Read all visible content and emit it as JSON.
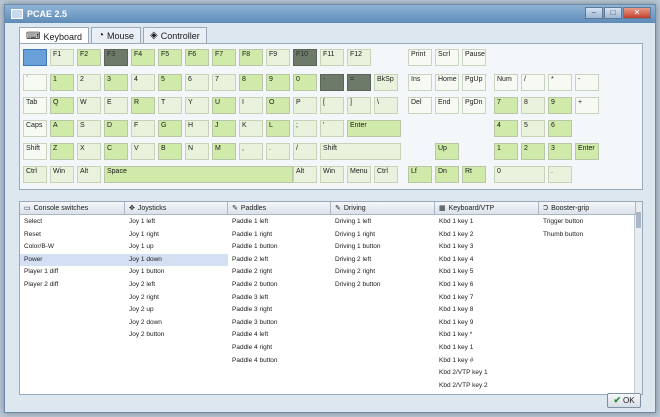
{
  "window": {
    "title": "PCAE 2.5"
  },
  "tabs": [
    {
      "label": "Keyboard",
      "icon": "keyboard-icon",
      "glyph": "⌨"
    },
    {
      "label": "Mouse",
      "icon": "mouse-icon",
      "glyph": "◔"
    },
    {
      "label": "Controller",
      "icon": "controller-icon",
      "glyph": "◈"
    }
  ],
  "keyboard": {
    "keys": [
      {
        "label": "",
        "style": "sel"
      },
      {
        "label": "F1",
        "style": "light"
      },
      {
        "label": "F2",
        "style": ""
      },
      {
        "label": "F3",
        "style": "dark"
      },
      {
        "label": "F4",
        "style": ""
      },
      {
        "label": "F5",
        "style": ""
      },
      {
        "label": "F6",
        "style": ""
      },
      {
        "label": "F7",
        "style": ""
      },
      {
        "label": "F8",
        "style": ""
      },
      {
        "label": "F9",
        "style": "light"
      },
      {
        "label": "F10",
        "style": "dark"
      },
      {
        "label": "F11",
        "style": "light"
      },
      {
        "label": "F12",
        "style": "light"
      },
      {
        "label": "Print",
        "style": "plain"
      },
      {
        "label": "Scrl",
        "style": "plain"
      },
      {
        "label": "Pause",
        "style": "plain"
      },
      {
        "label": "`",
        "style": "plain"
      },
      {
        "label": "1",
        "style": ""
      },
      {
        "label": "2",
        "style": "light"
      },
      {
        "label": "3",
        "style": ""
      },
      {
        "label": "4",
        "style": "light"
      },
      {
        "label": "5",
        "style": ""
      },
      {
        "label": "6",
        "style": "light"
      },
      {
        "label": "7",
        "style": "light"
      },
      {
        "label": "8",
        "style": ""
      },
      {
        "label": "9",
        "style": ""
      },
      {
        "label": "0",
        "style": ""
      },
      {
        "label": "-",
        "style": "dark"
      },
      {
        "label": "=",
        "style": "dark"
      },
      {
        "label": "BkSp",
        "style": "light"
      },
      {
        "label": "Ins",
        "style": "plain"
      },
      {
        "label": "Home",
        "style": "plain"
      },
      {
        "label": "PgUp",
        "style": "plain"
      },
      {
        "label": "Num",
        "style": "plain"
      },
      {
        "label": "/",
        "style": "plain"
      },
      {
        "label": "*",
        "style": "plain"
      },
      {
        "label": "-",
        "style": "plain"
      },
      {
        "label": "Tab",
        "style": "plain"
      },
      {
        "label": "Q",
        "style": ""
      },
      {
        "label": "W",
        "style": "light"
      },
      {
        "label": "E",
        "style": "light"
      },
      {
        "label": "R",
        "style": ""
      },
      {
        "label": "T",
        "style": "light"
      },
      {
        "label": "Y",
        "style": "light"
      },
      {
        "label": "U",
        "style": ""
      },
      {
        "label": "I",
        "style": "light"
      },
      {
        "label": "O",
        "style": ""
      },
      {
        "label": "P",
        "style": "light"
      },
      {
        "label": "[",
        "style": "light"
      },
      {
        "label": "]",
        "style": "light"
      },
      {
        "label": "\\",
        "style": "light"
      },
      {
        "label": "Del",
        "style": "plain"
      },
      {
        "label": "End",
        "style": "plain"
      },
      {
        "label": "PgDn",
        "style": "plain"
      },
      {
        "label": "7",
        "style": ""
      },
      {
        "label": "8",
        "style": "light"
      },
      {
        "label": "9",
        "style": ""
      },
      {
        "label": "+",
        "style": "plain"
      },
      {
        "label": "Caps",
        "style": "plain"
      },
      {
        "label": "A",
        "style": ""
      },
      {
        "label": "S",
        "style": "light"
      },
      {
        "label": "D",
        "style": ""
      },
      {
        "label": "F",
        "style": "light"
      },
      {
        "label": "G",
        "style": ""
      },
      {
        "label": "H",
        "style": "light"
      },
      {
        "label": "J",
        "style": ""
      },
      {
        "label": "K",
        "style": "light"
      },
      {
        "label": "L",
        "style": ""
      },
      {
        "label": ";",
        "style": "light"
      },
      {
        "label": "'",
        "style": "light"
      },
      {
        "label": "Enter",
        "style": ""
      },
      {
        "label": "4",
        "style": ""
      },
      {
        "label": "5",
        "style": "light"
      },
      {
        "label": "6",
        "style": ""
      },
      {
        "label": "Shift",
        "style": "plain"
      },
      {
        "label": "Z",
        "style": ""
      },
      {
        "label": "X",
        "style": "light"
      },
      {
        "label": "C",
        "style": ""
      },
      {
        "label": "V",
        "style": "light"
      },
      {
        "label": "B",
        "style": ""
      },
      {
        "label": "N",
        "style": "light"
      },
      {
        "label": "M",
        "style": ""
      },
      {
        "label": ",",
        "style": "light"
      },
      {
        "label": ".",
        "style": "light"
      },
      {
        "label": "/",
        "style": "light"
      },
      {
        "label": "Shift",
        "style": "light"
      },
      {
        "label": "Up",
        "style": ""
      },
      {
        "label": "1",
        "style": ""
      },
      {
        "label": "2",
        "style": ""
      },
      {
        "label": "3",
        "style": ""
      },
      {
        "label": "Enter",
        "style": ""
      },
      {
        "label": "Ctrl",
        "style": "light"
      },
      {
        "label": "Win",
        "style": "light"
      },
      {
        "label": "Alt",
        "style": "light"
      },
      {
        "label": "Space",
        "style": ""
      },
      {
        "label": "Alt",
        "style": "light"
      },
      {
        "label": "Win",
        "style": "light"
      },
      {
        "label": "Menu",
        "style": "light"
      },
      {
        "label": "Ctrl",
        "style": "light"
      },
      {
        "label": "Lf",
        "style": ""
      },
      {
        "label": "Dn",
        "style": ""
      },
      {
        "label": "Rt",
        "style": ""
      },
      {
        "label": "0",
        "style": "light"
      },
      {
        "label": ".",
        "style": "light"
      }
    ]
  },
  "columns": [
    {
      "header": "Console switches",
      "icon": "console-icon",
      "glyph": "▭",
      "items": [
        "Select",
        "Reset",
        "Color/B-W",
        "Power",
        "Player 1 diff",
        "Player 2 diff"
      ],
      "highlight": 3
    },
    {
      "header": "Joysticks",
      "icon": "joystick-icon",
      "glyph": "✥",
      "items": [
        "Joy 1 left",
        "Joy 1 right",
        "Joy 1 up",
        "Joy 1 down",
        "Joy 1 button",
        "Joy 2 left",
        "Joy 2 right",
        "Joy 2 up",
        "Joy 2 down",
        "Joy 2 button"
      ],
      "highlight": 3
    },
    {
      "header": "Paddles",
      "icon": "paddle-icon",
      "glyph": "✎",
      "items": [
        "Paddle 1 left",
        "Paddle 1 right",
        "Paddle 1 button",
        "Paddle 2 left",
        "Paddle 2 right",
        "Paddle 2 button",
        "Paddle 3 left",
        "Paddle 3 right",
        "Paddle 3 button",
        "Paddle 4 left",
        "Paddle 4 right",
        "Paddle 4 button"
      ],
      "highlight": -1
    },
    {
      "header": "Driving",
      "icon": "driving-icon",
      "glyph": "✎",
      "items": [
        "Driving 1 left",
        "Driving 1 right",
        "Driving 1 button",
        "Driving 2 left",
        "Driving 2 right",
        "Driving 2 button"
      ],
      "highlight": -1
    },
    {
      "header": "Keyboard/VTP",
      "icon": "keypad-icon",
      "glyph": "▦",
      "items": [
        "Kbd 1 key 1",
        "Kbd 1 key 2",
        "Kbd 1 key 3",
        "Kbd 1 key 4",
        "Kbd 1 key 5",
        "Kbd 1 key 6",
        "Kbd 1 key 7",
        "Kbd 1 key 8",
        "Kbd 1 key 9",
        "Kbd 1 key *",
        "Kbd 1 key 1",
        "Kbd 1 key #",
        "Kbd 2/VTP key 1",
        "Kbd 2/VTP key 2"
      ],
      "highlight": -1
    },
    {
      "header": "Booster-grip",
      "icon": "booster-icon",
      "glyph": "Ɔ",
      "items": [
        "Trigger button",
        "Thumb button"
      ],
      "highlight": -1
    }
  ],
  "ok_button": {
    "label": "OK"
  },
  "colors": {
    "mapped_key": "#cfeaa9",
    "selected_key": "#6aa0d8",
    "unavailable_key": "#6d7a6a",
    "highlight_row": "#d3dff3"
  }
}
